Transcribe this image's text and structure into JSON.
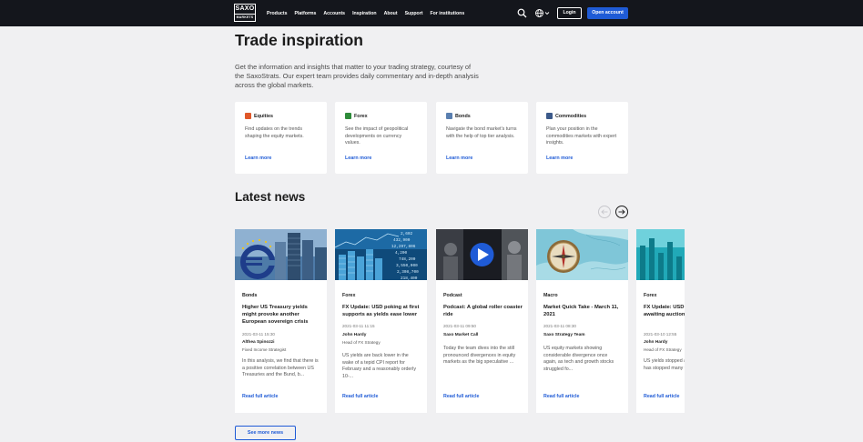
{
  "nav": {
    "logo_top": "SAXO",
    "logo_bottom": "MARKETS",
    "menu": [
      "Products",
      "Platforms",
      "Accounts",
      "Inspiration",
      "About",
      "Support",
      "For institutions"
    ],
    "login": "Login",
    "open_account": "Open account"
  },
  "page": {
    "title": "Trade inspiration",
    "intro": "Get the information and insights that matter to your trading strategy, courtesy of the SaxoStrats. Our expert team provides daily commentary and in-depth analysis across the global markets."
  },
  "categories": [
    {
      "title": "Equities",
      "desc": "Find updates on the trends shaping the equity markets.",
      "link": "Learn more",
      "icon_color": "#e0582a"
    },
    {
      "title": "Forex",
      "desc": "See the impact of geopolitical developments on currency values.",
      "link": "Learn more",
      "icon_color": "#2e8b3a"
    },
    {
      "title": "Bonds",
      "desc": "Navigate the bond market's turns with the help of top tier analysis.",
      "link": "Learn more",
      "icon_color": "#5a7fb0"
    },
    {
      "title": "Commodities",
      "desc": "Plan your position in the commodities markets with expert insights.",
      "link": "Learn more",
      "icon_color": "#3c5a8a"
    }
  ],
  "news": {
    "title": "Latest news",
    "see_more": "See more news",
    "cards": [
      {
        "category": "Bonds",
        "title": "Higher US Treasury yields might provoke another European sovereign crisis",
        "date": "2021-03-11 15:30",
        "author": "Althea Spinozzi",
        "role": "Fixed Income Strategist",
        "excerpt": "In this analysis, we find that there is a positive correlation between US Treasuries and the Bund, b...",
        "read": "Read full article"
      },
      {
        "category": "Forex",
        "title": "FX Update: USD poking at first supports as yields ease lower",
        "date": "2021-03-11 11:15",
        "author": "John Hardy",
        "role": "Head of FX Strategy",
        "excerpt": "US yields are back lower in the wake of a tepid CPI report for February and a reasonably orderly 10-...",
        "read": "Read full article"
      },
      {
        "category": "Podcast",
        "title": "Podcast: A global roller coaster ride",
        "date": "2021-03-11 09:50",
        "author": "Saxo Market Call",
        "role": "",
        "excerpt": "Today the team dives into the still pronounced divergences in equity markets as the big speculative ...",
        "read": "Read full article"
      },
      {
        "category": "Macro",
        "title": "Market Quick Take - March 11, 2021",
        "date": "2021-03-11 08:30",
        "author": "Saxo Strategy Team",
        "role": "",
        "excerpt": "US equity markets showing considerable divergence once again, as tech and growth stocks struggled fo...",
        "read": "Read full article"
      },
      {
        "category": "Forex",
        "title": "FX Update: USD crossroads, awaiting auctions, FOMC",
        "date": "2021-03-10 12:55",
        "author": "John Hardy",
        "role": "Head of FX Strategy",
        "excerpt": "US yields stopped and the US dollar has stopped many treasury auctions",
        "read": "Read full article"
      }
    ]
  }
}
